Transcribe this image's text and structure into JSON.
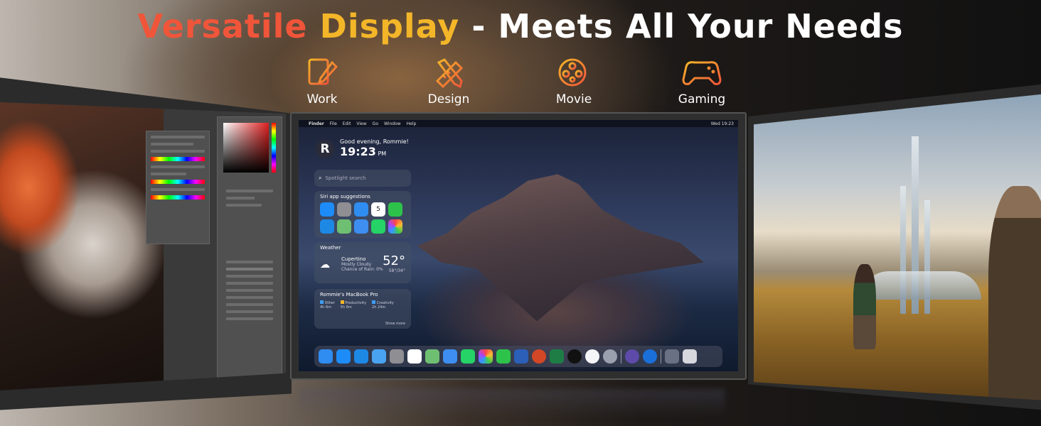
{
  "headline": {
    "part1": "Versatile",
    "part2": "Display",
    "part3": "- Meets All Your Needs"
  },
  "categories": [
    {
      "label": "Work",
      "icon": "document-pen-icon"
    },
    {
      "label": "Design",
      "icon": "ruler-pencil-icon"
    },
    {
      "label": "Movie",
      "icon": "film-reel-icon"
    },
    {
      "label": "Gaming",
      "icon": "gamepad-icon"
    }
  ],
  "colors": {
    "red": "#f0553a",
    "yellow": "#f3b628",
    "icon_orange": "#f06a2e"
  },
  "mac": {
    "menubar": {
      "apple": "",
      "app": "Finder",
      "items": [
        "File",
        "Edit",
        "View",
        "Go",
        "Window",
        "Help"
      ],
      "clock": "Wed 19:23"
    },
    "greeting": "Good evening, Rommie!",
    "time": "19:23",
    "ampm": "PM",
    "logo_letter": "R",
    "search_placeholder": "Spotlight search",
    "siri": {
      "title": "Siri app suggestions"
    },
    "calendar_day": "5",
    "weather": {
      "title": "Weather",
      "city": "Cupertino",
      "condition": "Mostly Cloudy",
      "rain": "Chance of Rain: 0%",
      "temp": "52°",
      "range": "58°/34°"
    },
    "battery": {
      "title": "Rommie's MacBook Pro",
      "items": [
        {
          "label": "Other",
          "value": "4h 6m"
        },
        {
          "label": "Productivity",
          "value": "5h 6m"
        },
        {
          "label": "Creativity",
          "value": "2h 24m"
        }
      ],
      "show_more": "Show more"
    }
  }
}
